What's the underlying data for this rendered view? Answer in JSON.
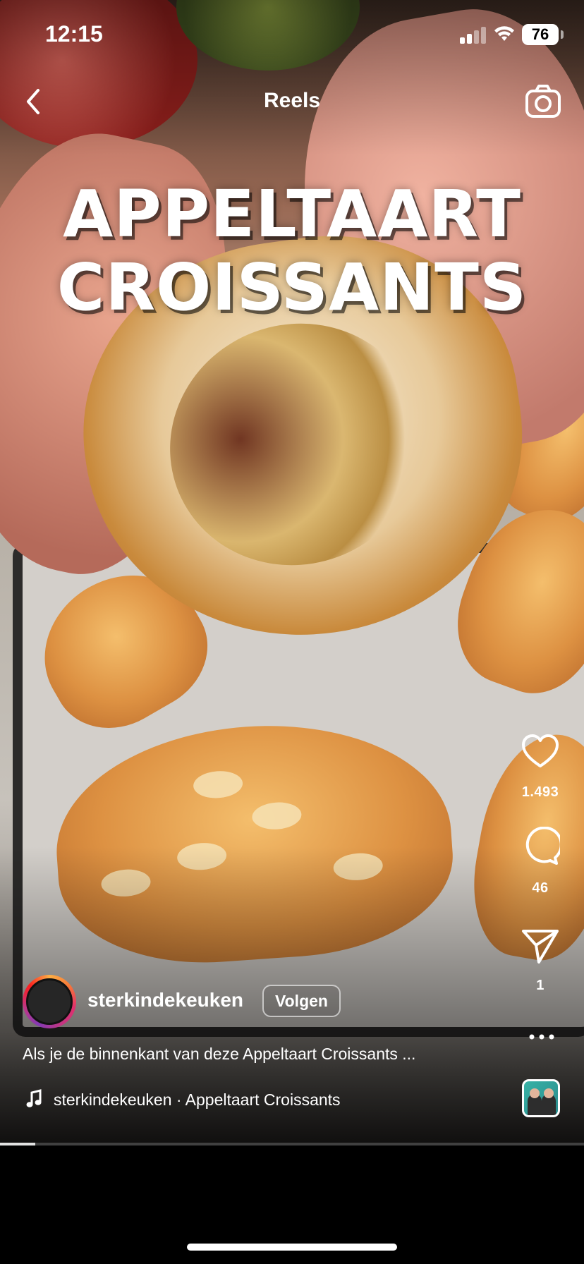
{
  "status_bar": {
    "time": "12:15",
    "battery_level": "76"
  },
  "header": {
    "title": "Reels"
  },
  "video": {
    "overlay_title_line1": "APPELTAART",
    "overlay_title_line2": "CROISSANTS",
    "progress_fraction": 0.06
  },
  "actions": {
    "likes_count": "1.493",
    "comments_count": "46",
    "shares_count": "1"
  },
  "author": {
    "username": "sterkindekeuken",
    "follow_label": "Volgen"
  },
  "caption": "Als je de binnenkant van deze Appeltaart Croissants ...",
  "audio": {
    "label": "sterkindekeuken · Appeltaart Croissants"
  },
  "icons": [
    "back-icon",
    "camera-icon",
    "heart-icon",
    "comment-icon",
    "share-icon",
    "more-icon",
    "music-note-icon",
    "wifi-icon"
  ],
  "colors": {
    "background": "#000000",
    "text": "#ffffff"
  }
}
